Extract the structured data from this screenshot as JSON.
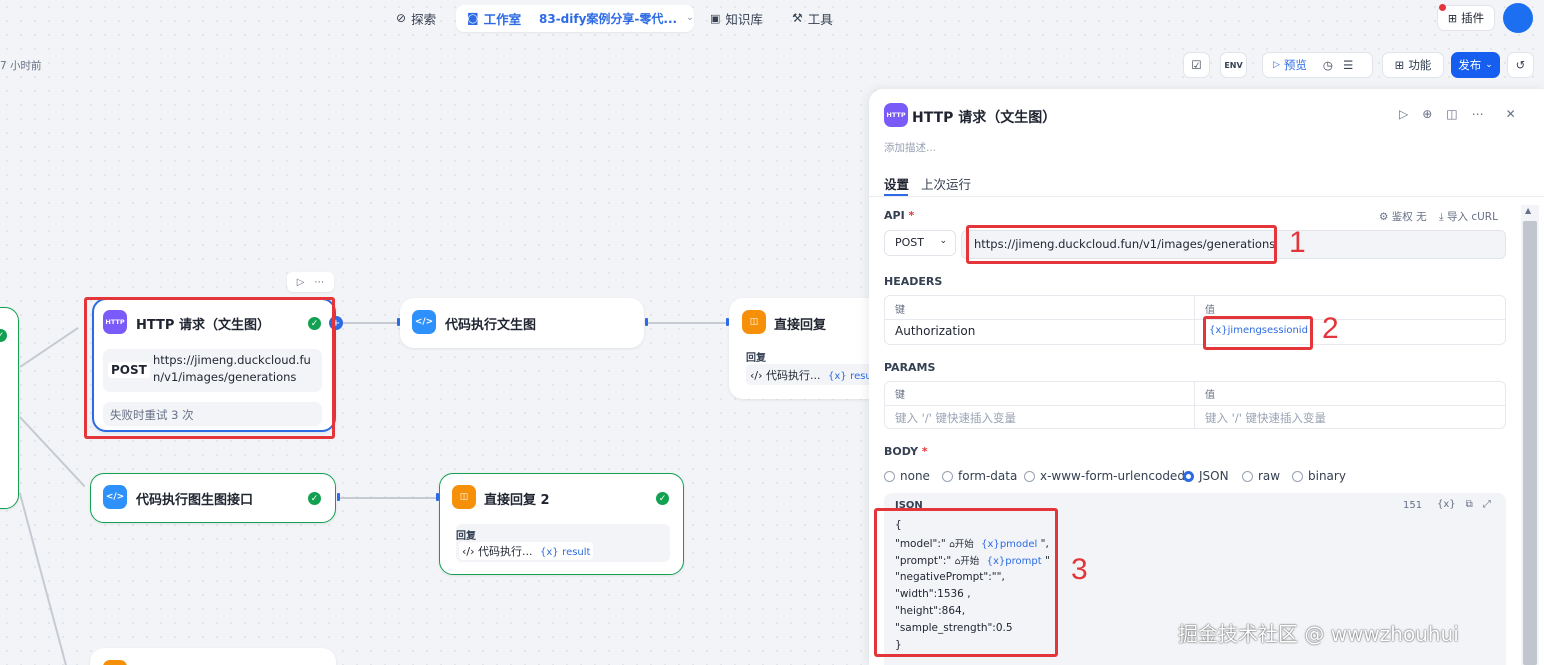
{
  "topnav": {
    "explore": "探索",
    "studio": "工作室",
    "app_name": "83-dify案例分享-零代...",
    "knowledge": "知识库",
    "tools": "工具",
    "plugins": "插件"
  },
  "toolbar": {
    "saved_time": "7 小时前",
    "preview": "预览",
    "features": "功能",
    "publish": "发布"
  },
  "canvas": {
    "http_node": {
      "title": "HTTP 请求（文生图）",
      "icon_text": "HTTP",
      "method": "POST",
      "url_line1": "https://jimeng.duckcloud.fu",
      "url_line2": "n/v1/images/generations",
      "retry": "失败时重试 3 次"
    },
    "code_node_1": {
      "title": "代码执行文生图"
    },
    "reply_node_1": {
      "title": "直接回复",
      "reply_label": "回复",
      "ref": "代码执行...",
      "var": "resu"
    },
    "code_node_2": {
      "title": "代码执行图生图接口"
    },
    "reply_node_2": {
      "title": "直接回复 2",
      "reply_label": "回复",
      "ref": "代码执行...",
      "var": "result"
    }
  },
  "panel": {
    "icon_text": "HTTP",
    "title": "HTTP 请求（文生图）",
    "description_placeholder": "添加描述...",
    "tabs": [
      "设置",
      "上次运行"
    ],
    "api_label": "API",
    "auth_label": "鉴权 无",
    "import_curl": "导入 cURL",
    "method": "POST",
    "url": "https://jimeng.duckcloud.fun/v1/images/generations",
    "headers_label": "HEADERS",
    "key_col": "键",
    "value_col": "值",
    "header_key": "Authorization",
    "header_value": "jimengsessionid",
    "params_label": "PARAMS",
    "params_placeholder": "键入 '/' 键快速插入变量",
    "body_label": "BODY",
    "body_types": [
      "none",
      "form-data",
      "x-www-form-urlencoded",
      "JSON",
      "raw",
      "binary"
    ],
    "json_label": "JSON",
    "char_count": "151",
    "json_lines": {
      "open": "{",
      "model_key": "\"model\":\"",
      "model_src": "开始",
      "model_var": "pmodel",
      "model_end": "\",",
      "prompt_key": "\"prompt\":\"",
      "prompt_src": "开始",
      "prompt_var": "prompt",
      "prompt_end": "\"",
      "negative": "\"negativePrompt\":\"\",",
      "width": "\"width\":1536 ,",
      "height": "\"height\":864,",
      "strength": "\"sample_strength\":0.5",
      "close": "}"
    }
  },
  "annotations": [
    "1",
    "2",
    "3"
  ],
  "watermark": "掘金技术社区 @ wwwzhouhui"
}
